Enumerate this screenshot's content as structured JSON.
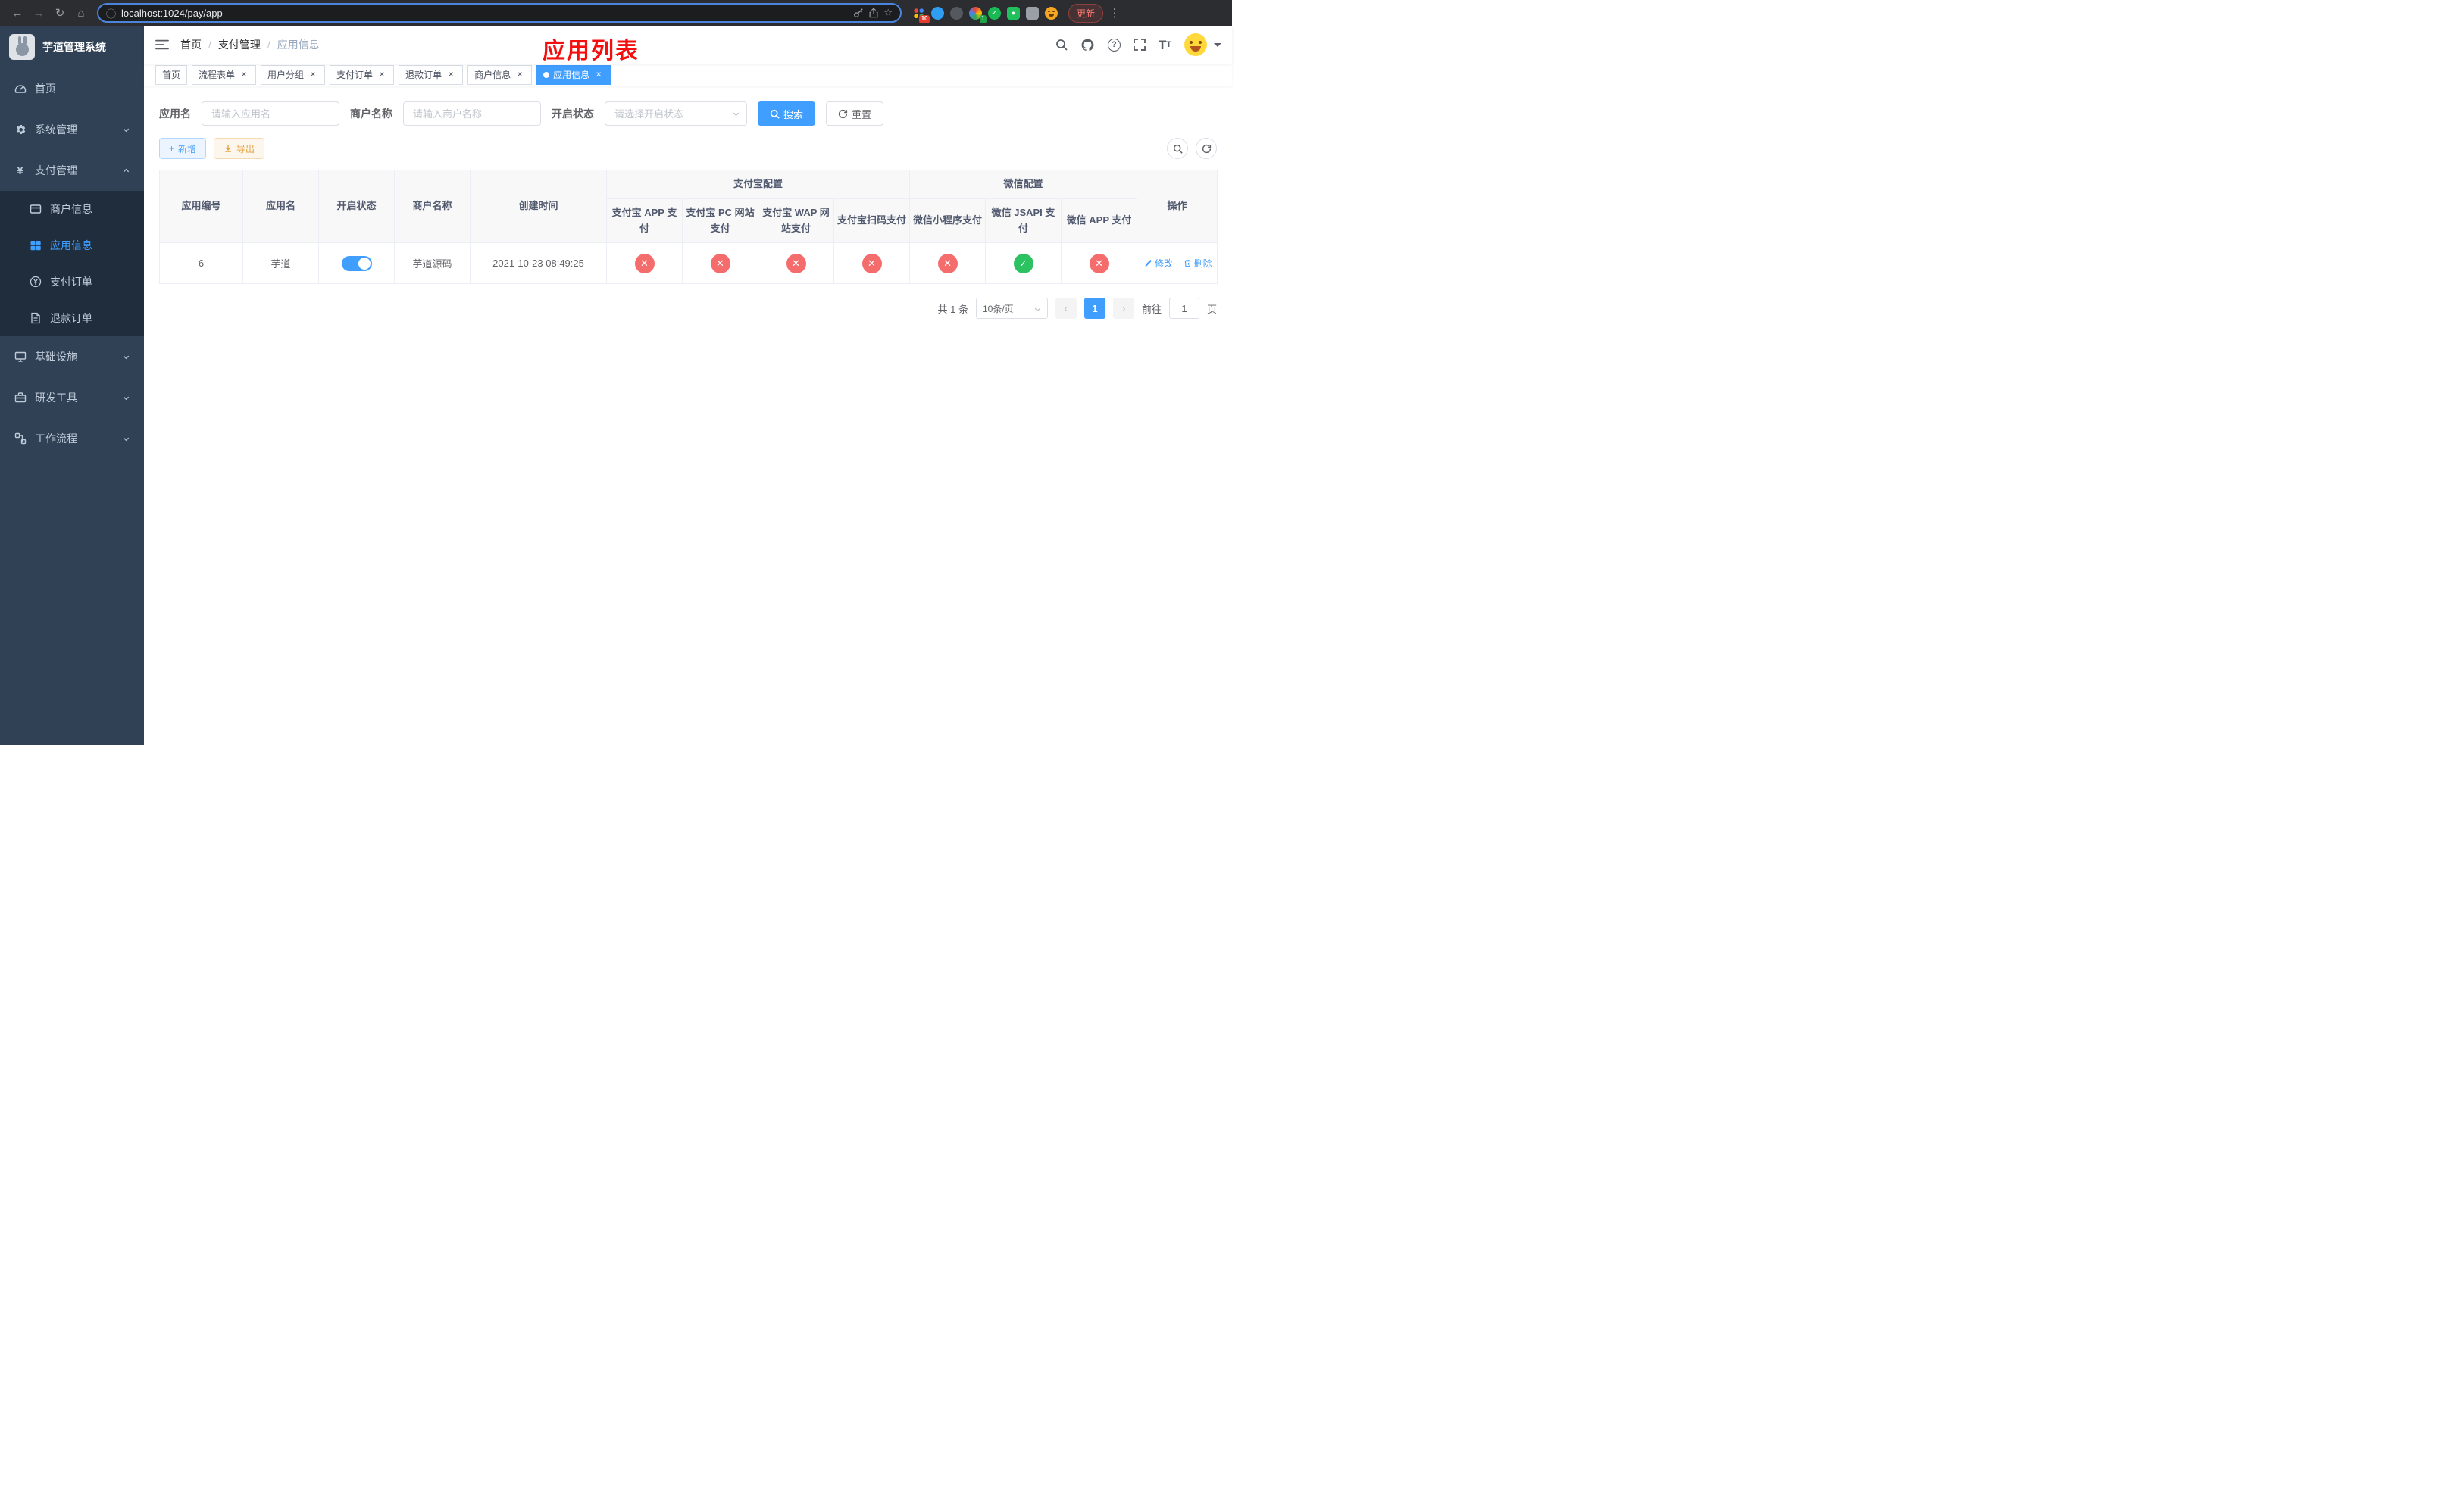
{
  "theme": {
    "primary": "#409eff",
    "success": "#2cc161",
    "danger": "#f56c6c",
    "warning": "#e6a23c",
    "annotation": "#f40f0f",
    "sidebar_bg": "#304156",
    "submenu_bg": "#1f2d3d"
  },
  "icons": {
    "back": "←",
    "forward": "→",
    "reload": "↻",
    "home": "⌂",
    "info": "ⓘ",
    "star": "☆",
    "menu": "⋮",
    "question": "?",
    "prev": "‹",
    "next": "›",
    "plus": "+",
    "close": "×"
  },
  "browser": {
    "url": "localhost:1024/pay/app",
    "update_label": "更新",
    "ext_badge_grid": "10",
    "ext_badge_avatar": "1"
  },
  "annotation": {
    "text": "应用列表"
  },
  "sidebar": {
    "logo_title": "芋道管理系统",
    "items": [
      {
        "label": "首页"
      },
      {
        "label": "系统管理"
      },
      {
        "label": "支付管理"
      },
      {
        "label": "商户信息"
      },
      {
        "label": "应用信息"
      },
      {
        "label": "支付订单"
      },
      {
        "label": "退款订单"
      },
      {
        "label": "基础设施"
      },
      {
        "label": "研发工具"
      },
      {
        "label": "工作流程"
      }
    ]
  },
  "navbar": {
    "breadcrumb": [
      "首页",
      "支付管理",
      "应用信息"
    ]
  },
  "tabs": [
    {
      "label": "首页"
    },
    {
      "label": "流程表单"
    },
    {
      "label": "用户分组"
    },
    {
      "label": "支付订单"
    },
    {
      "label": "退款订单"
    },
    {
      "label": "商户信息"
    },
    {
      "label": "应用信息"
    }
  ],
  "filters": {
    "app_name_label": "应用名",
    "app_name_placeholder": "请输入应用名",
    "merchant_label": "商户名称",
    "merchant_placeholder": "请输入商户名称",
    "status_label": "开启状态",
    "status_placeholder": "请选择开启状态",
    "search_label": "搜索",
    "reset_label": "重置"
  },
  "toolbar": {
    "add_label": "新增",
    "export_label": "导出"
  },
  "table": {
    "headers": {
      "id": "应用编号",
      "name": "应用名",
      "status": "开启状态",
      "merchant": "商户名称",
      "created": "创建时间",
      "alipay_group": "支付宝配置",
      "wechat_group": "微信配置",
      "alipay_app": "支付宝 APP 支付",
      "alipay_pc": "支付宝 PC 网站支付",
      "alipay_wap": "支付宝 WAP 网站支付",
      "alipay_qr": "支付宝扫码支付",
      "wechat_lite": "微信小程序支付",
      "wechat_jsapi": "微信 JSAPI 支付",
      "wechat_app": "微信 APP 支付",
      "op": "操作"
    },
    "row": {
      "id": "6",
      "name": "芋道",
      "enabled": true,
      "merchant": "芋道源码",
      "created": "2021-10-23 08:49:25",
      "channels": [
        "no",
        "no",
        "no",
        "no",
        "no",
        "yes",
        "no"
      ],
      "edit_label": "修改",
      "delete_label": "删除"
    }
  },
  "pagination": {
    "total": "共 1 条",
    "page_size": "10条/页",
    "current": "1",
    "goto_label": "前往",
    "goto_value": "1",
    "page_label": "页"
  }
}
